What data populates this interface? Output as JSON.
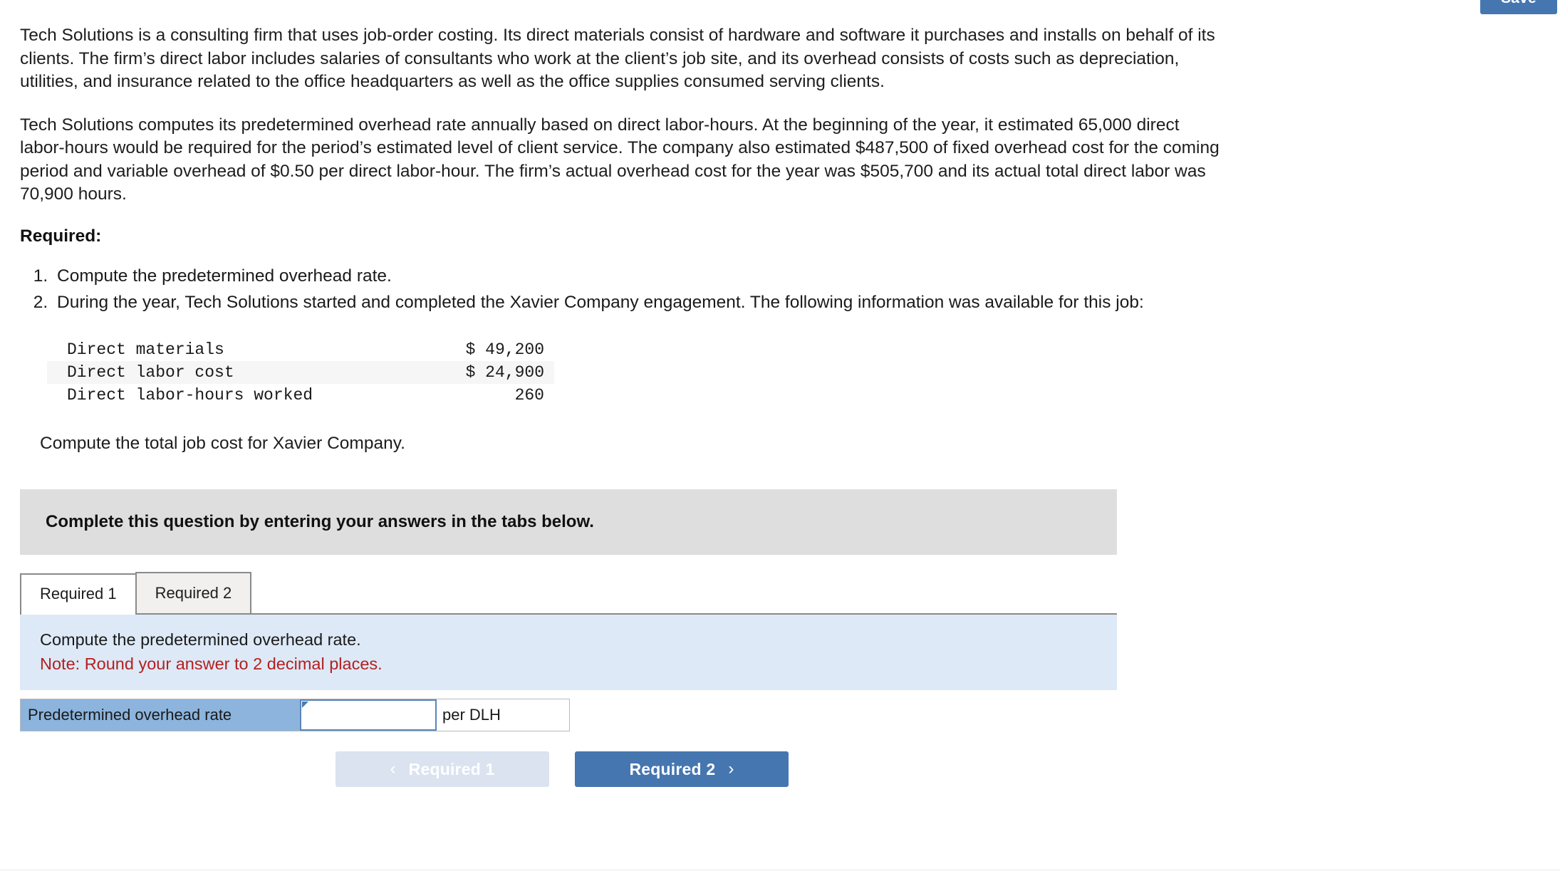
{
  "top_button": {
    "label": "Save"
  },
  "problem": {
    "paragraph_1": "Tech Solutions is a consulting firm that uses job-order costing. Its direct materials consist of hardware and software it purchases and installs on behalf of its clients. The firm’s direct labor includes salaries of consultants who work at the client’s job site, and its overhead consists of costs such as depreciation, utilities, and insurance related to the office headquarters as well as the office supplies consumed serving clients.",
    "paragraph_2": "Tech Solutions computes its predetermined overhead rate annually based on direct labor-hours. At the beginning of the year, it estimated 65,000 direct labor-hours would be required for the period’s estimated level of client service. The company also estimated $487,500 of fixed overhead cost for the coming period and variable overhead of $0.50 per direct labor-hour. The firm’s actual overhead cost for the year was $505,700 and its actual total direct labor was 70,900 hours.",
    "required_heading": "Required:",
    "requirements": [
      "Compute the predetermined overhead rate.",
      "During the year, Tech Solutions started and completed the Xavier Company engagement. The following information was available for this job:"
    ],
    "job_data_rows": [
      {
        "label": "Direct materials",
        "value": "$ 49,200"
      },
      {
        "label": "Direct labor cost",
        "value": "$ 24,900"
      },
      {
        "label": "Direct labor-hours worked",
        "value": "260"
      }
    ],
    "compute_line": "Compute the total job cost for Xavier Company."
  },
  "banner": {
    "text": "Complete this question by entering your answers in the tabs below."
  },
  "tabs": [
    {
      "label": "Required 1",
      "active": true
    },
    {
      "label": "Required 2",
      "active": false
    }
  ],
  "note_panel": {
    "instruction": "Compute the predetermined overhead rate.",
    "note": "Note: Round your answer to 2 decimal places."
  },
  "answer_row": {
    "label": "Predetermined overhead rate",
    "value": "",
    "placeholder": "",
    "unit": "per DLH"
  },
  "nav": {
    "prev_label": "Required 1",
    "prev_chevron": "‹",
    "next_label": "Required 2",
    "next_chevron": "›"
  },
  "colors": {
    "accent_blue": "#4676b0",
    "label_blue": "#8cb4dd",
    "panel_blue": "#dde9f7",
    "banner_gray": "#dedede",
    "note_red": "#b32020"
  }
}
